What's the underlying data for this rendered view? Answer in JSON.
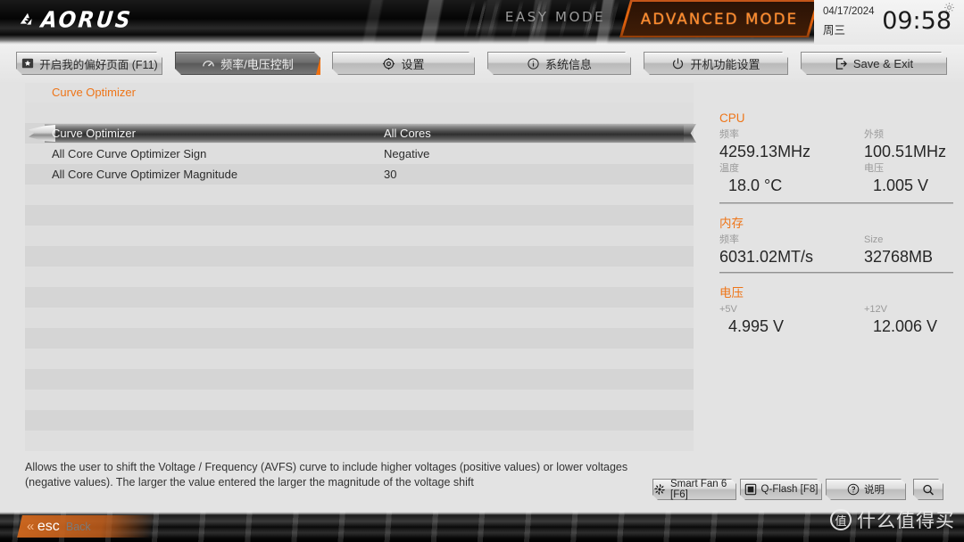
{
  "header": {
    "brand": "AORUS",
    "brand_icon": "aorus-falcon-icon",
    "easy_mode_label": "EASY MODE",
    "advanced_mode_label": "ADVANCED MODE",
    "gear_icon": "gear-icon",
    "clock": {
      "date": "04/17/2024",
      "weekday": "周三",
      "time": "09:58"
    }
  },
  "nav": {
    "tabs": [
      {
        "id": "favorites",
        "label": "开启我的偏好页面 (F11)",
        "icon": "star-box-icon",
        "active": false
      },
      {
        "id": "freqvolt",
        "label": "频率/电压控制",
        "icon": "gauge-icon",
        "active": true
      },
      {
        "id": "settings",
        "label": "设置",
        "icon": "gear-icon",
        "active": false
      },
      {
        "id": "sysinfo",
        "label": "系统信息",
        "icon": "info-icon",
        "active": false
      },
      {
        "id": "bootfunc",
        "label": "开机功能设置",
        "icon": "power-icon",
        "active": false
      },
      {
        "id": "saveexit",
        "label": "Save & Exit",
        "icon": "exit-icon",
        "active": false
      }
    ]
  },
  "content": {
    "title": "Curve Optimizer",
    "rows": [
      {
        "label": "Curve Optimizer",
        "value": "All Cores",
        "selected": true
      },
      {
        "label": "All Core Curve Optimizer Sign",
        "value": "Negative",
        "selected": false
      },
      {
        "label": "All Core Curve Optimizer Magnitude",
        "value": "30",
        "selected": false
      }
    ]
  },
  "sidebar": {
    "cpu": {
      "heading": "CPU",
      "freq_key": "频率",
      "freq_val": "4259.13MHz",
      "bclk_key": "外频",
      "bclk_val": "100.51MHz",
      "temp_key": "温度",
      "temp_val": "18.0 °C",
      "volt_key": "电压",
      "volt_val": "1.005 V"
    },
    "memory": {
      "heading": "内存",
      "freq_key": "频率",
      "freq_val": "6031.02MT/s",
      "size_key": "Size",
      "size_val": "32768MB"
    },
    "voltage": {
      "heading": "电压",
      "v5_key": "+5V",
      "v5_val": "4.995 V",
      "v12_key": "+12V",
      "v12_val": "12.006 V"
    }
  },
  "help": {
    "text": "Allows the user to shift the Voltage / Frequency (AVFS) curve to include higher voltages (positive values) or lower voltages (negative values). The larger the value entered the larger the magnitude of the voltage shift"
  },
  "toolbar": {
    "smartfan_label": "Smart Fan 6 [F6]",
    "smartfan_icon": "fan-icon",
    "qflash_label": "Q-Flash [F8]",
    "qflash_icon": "chip-icon",
    "help_label": "说明",
    "help_icon": "question-circle-icon",
    "search_icon": "search-icon"
  },
  "footer": {
    "esc_chevron": "«",
    "esc_label": "esc",
    "esc_back": "Back"
  },
  "watermark": {
    "mark": "值",
    "text": "什么值得买"
  },
  "colors": {
    "accent_orange": "#ee7518",
    "advanced_orange": "#ff8a2a",
    "panel_bg": "#e0e0e0",
    "stripe_light": "#dedede",
    "stripe_dark": "#d5d5d5",
    "text_dark": "#2c2c2c",
    "text_muted": "#9a9a9a"
  }
}
